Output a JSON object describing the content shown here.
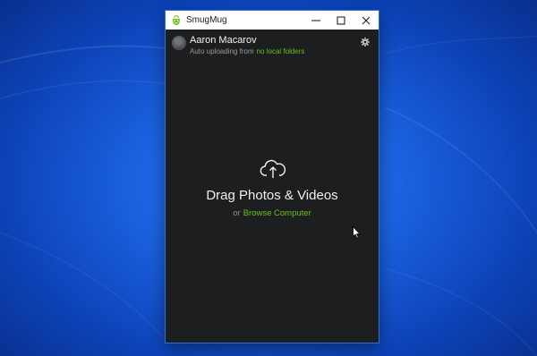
{
  "window": {
    "title": "SmugMug",
    "controls": {
      "minimize_icon": "minimize-icon",
      "maximize_icon": "maximize-icon",
      "close_icon": "close-icon"
    }
  },
  "account": {
    "name": "Aaron Macarov",
    "status_prefix": "Auto uploading from",
    "status_link": "no local folders",
    "settings_icon": "gear-icon"
  },
  "dropzone": {
    "icon": "cloud-upload-icon",
    "title": "Drag Photos & Videos",
    "or_text": "or",
    "browse_link": "Browse Computer"
  },
  "colors": {
    "accent_green": "#6bc119",
    "panel_bg": "#1d1e20",
    "desktop_blue": "#1b62e0"
  }
}
